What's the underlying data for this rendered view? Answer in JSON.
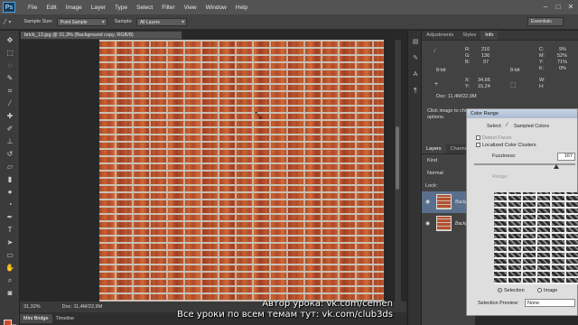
{
  "app": {
    "logo": "Ps"
  },
  "menu": [
    "File",
    "Edit",
    "Image",
    "Layer",
    "Type",
    "Select",
    "Filter",
    "View",
    "Window",
    "Help"
  ],
  "options_bar": {
    "sample_size_label": "Sample Size:",
    "sample_size_value": "Point Sample",
    "sample_label": "Sample:",
    "sample_value": "All Layers",
    "workspace": "Essentials"
  },
  "document": {
    "tab_title": "brick_13.jpg @ 31,3% (Background copy, RGB/8)",
    "zoom": "31,32%",
    "doc_info": "Doc: 11,4M/22,9M"
  },
  "bottom_tabs": [
    "Mini Bridge",
    "Timeline"
  ],
  "info_panel": {
    "tabs": [
      "Adjustments",
      "Styles",
      "Info"
    ],
    "rgb": {
      "R": "210",
      "G": "136",
      "B": "97"
    },
    "cmyk": {
      "C": "9%",
      "M": "52%",
      "Y": "71%",
      "K": "0%"
    },
    "bit_left": "8-bit",
    "bit_right": "8-bit",
    "x_label": "X:",
    "x": "34,66",
    "y_label": "Y:",
    "y": "15,24",
    "w_label": "W:",
    "h_label": "H:",
    "doc": "Doc: 11,4M/22,9M",
    "hint": "Click image to choose new color. Use Shift and Alt for additional options."
  },
  "layers_panel": {
    "tabs": [
      "Layers",
      "Channels"
    ],
    "filter": "Kind",
    "blend": "Normal",
    "lock_label": "Lock:",
    "layers": [
      {
        "name": "Background copy"
      },
      {
        "name": "Background"
      }
    ]
  },
  "color_range": {
    "title": "Color Range",
    "select_label": "Select:",
    "select_value": "Sampled Colors",
    "detect_faces": "Detect Faces",
    "localized": "Localized Color Clusters",
    "fuzziness_label": "Fuzziness:",
    "fuzziness": "167",
    "range_label": "Range:",
    "radio_selection": "Selection",
    "radio_image": "Image",
    "selection_preview_label": "Selection Preview:",
    "selection_preview_value": "None"
  },
  "watermark": {
    "line1": "Автор урока: vk.com/cemen",
    "line2": "Все уроки по всем темам тут: vk.com/club3ds"
  },
  "colors": {
    "foreground": "#d04a2d",
    "background": "#ffffff"
  }
}
